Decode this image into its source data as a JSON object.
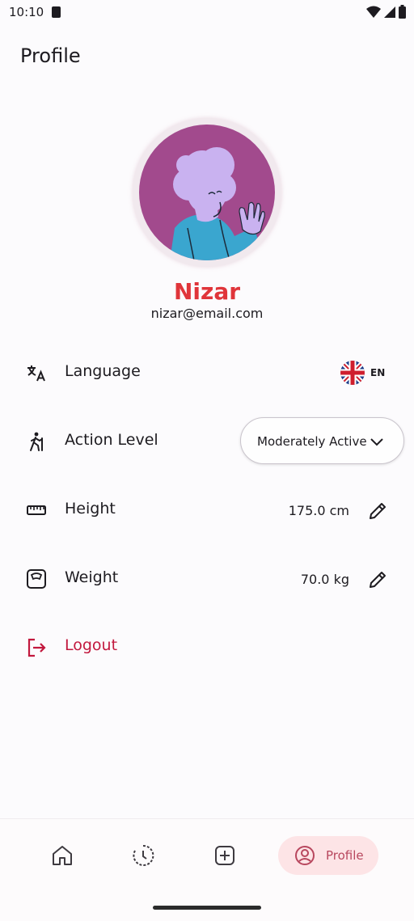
{
  "status_bar": {
    "time": "10:10"
  },
  "header": {
    "title": "Profile"
  },
  "profile": {
    "name": "Nizar",
    "email": "nizar@email.com"
  },
  "settings": {
    "language": {
      "label": "Language",
      "code": "EN",
      "icon": "translate-icon"
    },
    "activity": {
      "label": "Action Level",
      "value": "Moderately Active",
      "icon": "hiking-icon"
    },
    "height": {
      "label": "Height",
      "value": "175.0 cm",
      "icon": "ruler-icon"
    },
    "weight": {
      "label": "Weight",
      "value": "70.0 kg",
      "icon": "scale-icon"
    },
    "logout": {
      "label": "Logout",
      "icon": "logout-icon"
    }
  },
  "nav": {
    "items": [
      {
        "name": "home",
        "icon": "home-icon"
      },
      {
        "name": "history",
        "icon": "history-icon"
      },
      {
        "name": "add",
        "icon": "add-box-icon"
      },
      {
        "name": "profile",
        "icon": "person-circle-icon",
        "label": "Profile",
        "active": true
      }
    ]
  },
  "colors": {
    "name_red": "#e0353a",
    "logout_red": "#c2183e",
    "avatar_bg": "#a24a8d",
    "nav_active_bg": "#fde4e6"
  }
}
